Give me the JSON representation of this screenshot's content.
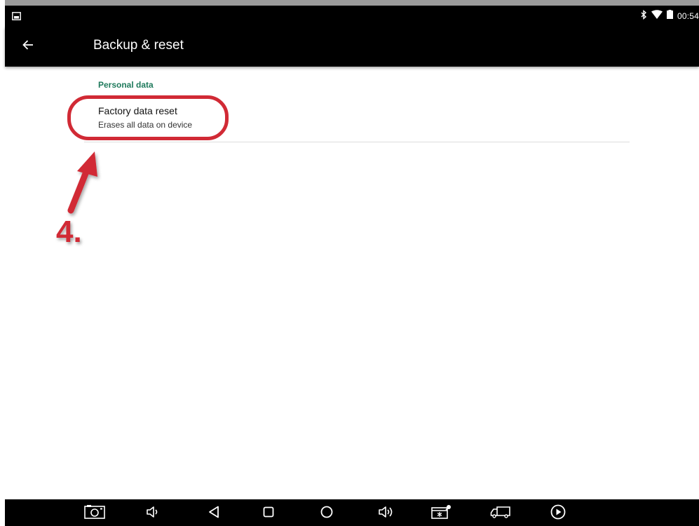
{
  "status_bar": {
    "time": "00:54",
    "icons": [
      "screenshot-notification-icon",
      "bluetooth-icon",
      "wifi-icon",
      "battery-icon"
    ]
  },
  "app_bar": {
    "title": "Backup & reset",
    "back_icon": "back-arrow-icon"
  },
  "settings": {
    "section_header": "Personal data",
    "items": [
      {
        "title": "Factory data reset",
        "summary": "Erases all data on device"
      }
    ]
  },
  "annotation": {
    "step_label": "4.",
    "color": "#d12a35"
  },
  "nav_bar": {
    "buttons": [
      "screenshot-icon",
      "volume-down-icon",
      "back-icon",
      "recents-icon",
      "home-icon",
      "volume-up-icon",
      "car-settings-icon",
      "truck-icon",
      "play-icon"
    ]
  },
  "colors": {
    "bar_background": "#000000",
    "section_header": "#1f7a5c",
    "annotation": "#d12a35"
  }
}
